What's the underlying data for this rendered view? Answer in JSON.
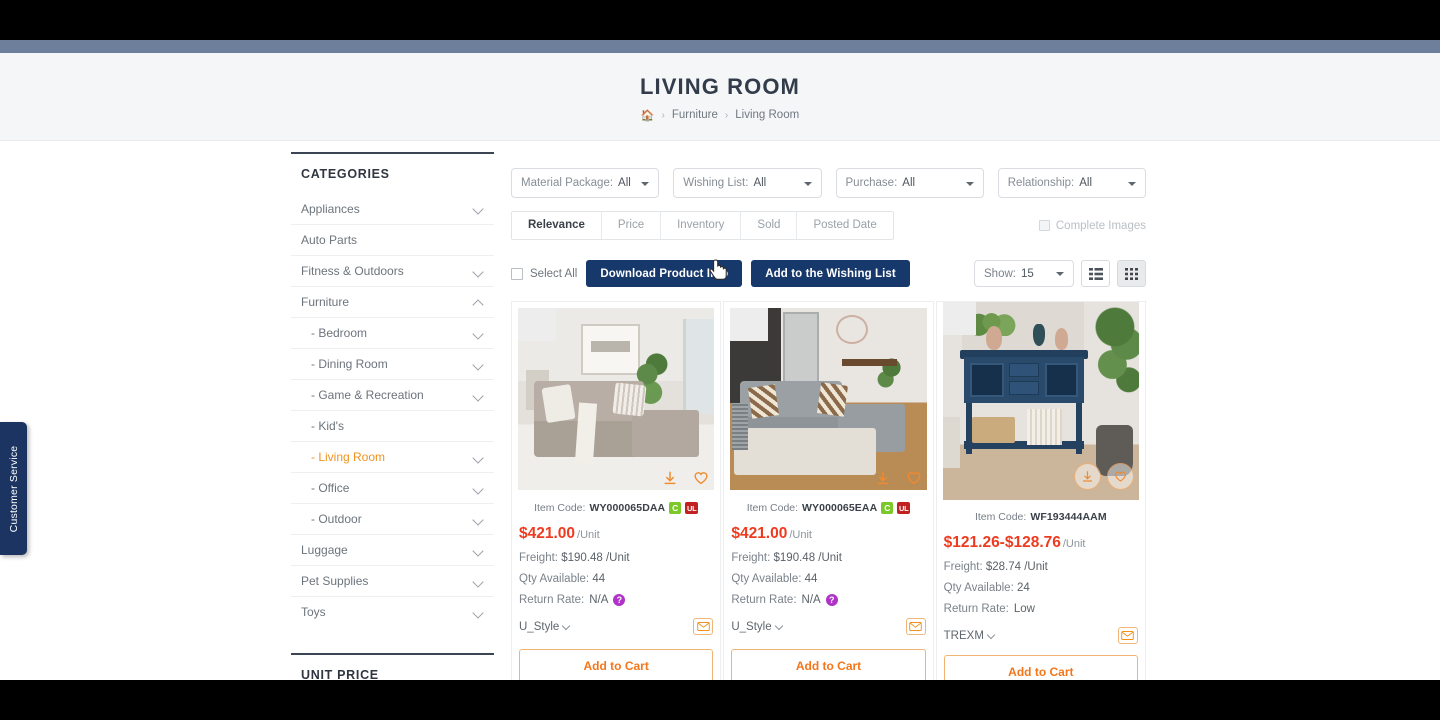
{
  "header": {
    "page_title": "LIVING ROOM",
    "breadcrumb": {
      "home_icon": "home-icon",
      "items": [
        "Furniture",
        "Living Room"
      ],
      "separator": "›"
    }
  },
  "customer_service_tab": {
    "label": "Customer Service"
  },
  "sidebar": {
    "categories_heading": "CATEGORIES",
    "unit_price_heading": "UNIT PRICE",
    "items": [
      {
        "label": "Appliances",
        "sub": false,
        "chevron": "chevron-down-icon",
        "active": false
      },
      {
        "label": "Auto Parts",
        "sub": false,
        "chevron": "",
        "active": false
      },
      {
        "label": "Fitness & Outdoors",
        "sub": false,
        "chevron": "chevron-down-icon",
        "active": false
      },
      {
        "label": "Furniture",
        "sub": false,
        "chevron": "chevron-up-icon",
        "active": false
      },
      {
        "label": "- Bedroom",
        "sub": true,
        "chevron": "chevron-down-icon",
        "active": false
      },
      {
        "label": "- Dining Room",
        "sub": true,
        "chevron": "chevron-down-icon",
        "active": false
      },
      {
        "label": "- Game & Recreation",
        "sub": true,
        "chevron": "chevron-down-icon",
        "active": false
      },
      {
        "label": "- Kid's",
        "sub": true,
        "chevron": "",
        "active": false
      },
      {
        "label": "- Living Room",
        "sub": true,
        "chevron": "chevron-down-icon",
        "active": true
      },
      {
        "label": "- Office",
        "sub": true,
        "chevron": "chevron-down-icon",
        "active": false
      },
      {
        "label": "- Outdoor",
        "sub": true,
        "chevron": "chevron-down-icon",
        "active": false
      },
      {
        "label": "Luggage",
        "sub": false,
        "chevron": "chevron-down-icon",
        "active": false
      },
      {
        "label": "Pet Supplies",
        "sub": false,
        "chevron": "chevron-down-icon",
        "active": false
      },
      {
        "label": "Toys",
        "sub": false,
        "chevron": "chevron-down-icon",
        "active": false
      }
    ]
  },
  "filters": [
    {
      "label": "Material Package:",
      "value": "All"
    },
    {
      "label": "Wishing List:",
      "value": "All"
    },
    {
      "label": "Purchase:",
      "value": "All"
    },
    {
      "label": "Relationship:",
      "value": "All"
    }
  ],
  "sort_tabs": [
    {
      "label": "Relevance",
      "active": true
    },
    {
      "label": "Price",
      "active": false
    },
    {
      "label": "Inventory",
      "active": false
    },
    {
      "label": "Sold",
      "active": false
    },
    {
      "label": "Posted Date",
      "active": false
    }
  ],
  "complete_images": {
    "label": "Complete Images",
    "checked": false
  },
  "action_bar": {
    "select_all": "Select All",
    "download_product_info": "Download Product Info",
    "add_to_wishing_list": "Add to the Wishing List",
    "show_label": "Show:",
    "show_value": "15",
    "list_view_icon": "list-view-icon",
    "grid_view_icon": "grid-view-icon",
    "active_view": "grid"
  },
  "labels": {
    "item_code": "Item Code:",
    "freight": "Freight:",
    "qty_available": "Qty Available:",
    "return_rate": "Return Rate:",
    "per_unit": "/Unit",
    "add_to_cart": "Add to Cart",
    "help_icon": "question-mark-icon",
    "download_icon": "download-icon",
    "wishlist_icon": "heart-icon",
    "mail_icon": "envelope-icon"
  },
  "products": [
    {
      "item_code": "WY000065DAA",
      "badges": [
        "C",
        "UL"
      ],
      "price": "$421.00",
      "freight": "$190.48 /Unit",
      "qty_available": "44",
      "return_rate": "N/A",
      "return_rate_has_help": true,
      "brand": "U_Style"
    },
    {
      "item_code": "WY000065EAA",
      "badges": [
        "C",
        "UL"
      ],
      "price": "$421.00",
      "freight": "$190.48 /Unit",
      "qty_available": "44",
      "return_rate": "N/A",
      "return_rate_has_help": true,
      "brand": "U_Style"
    },
    {
      "item_code": "WF193444AAM",
      "badges": [],
      "price": "$121.26-$128.76",
      "freight": "$28.74 /Unit",
      "qty_available": "24",
      "return_rate": "Low",
      "return_rate_has_help": false,
      "brand": "TREXM"
    }
  ],
  "colors": {
    "accent_orange": "#f4761b",
    "price_red": "#ee3b1f",
    "navy_button": "#17386b",
    "active_category": "#f0921f",
    "badge_green": "#7bc82b",
    "badge_red": "#c22121",
    "help_purple": "#b033c9"
  }
}
